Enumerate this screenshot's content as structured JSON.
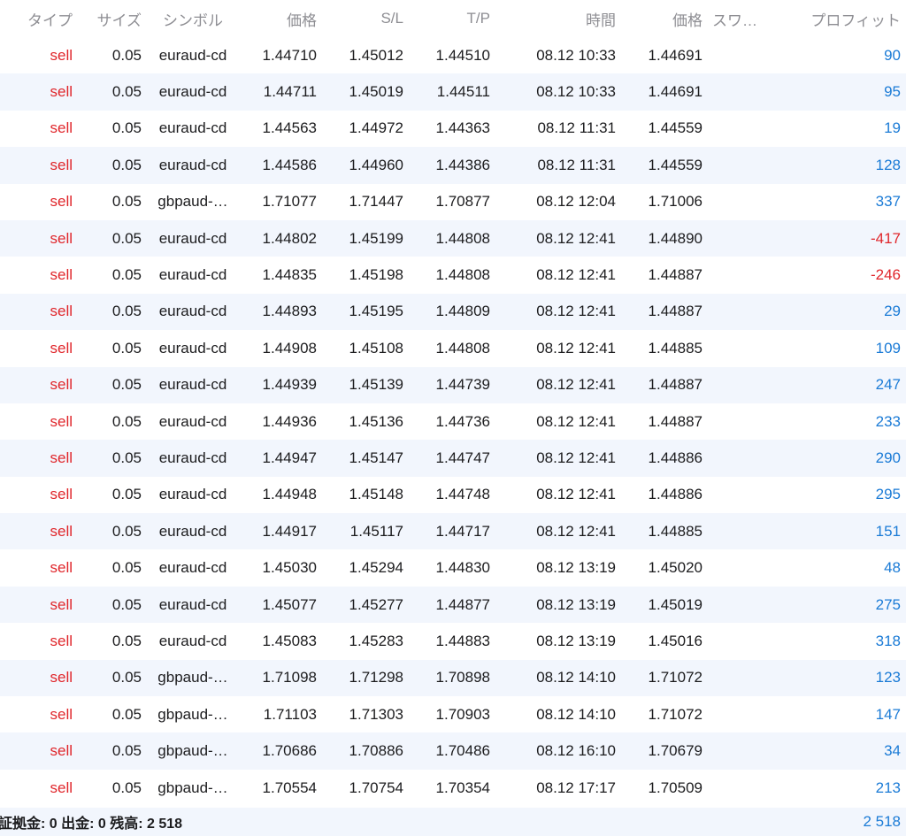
{
  "header": {
    "type": "タイプ",
    "size": "サイズ",
    "symbol": "シンボル",
    "price": "価格",
    "sl": "S/L",
    "tp": "T/P",
    "time": "時間",
    "price2": "価格",
    "swap": "スワ…",
    "profit": "プロフィット"
  },
  "colors": {
    "sell": "#e0262b",
    "positive": "#1b7bd6",
    "negative": "#e0262b",
    "row_alt_bg": "#f2f6fd",
    "header_text": "#8e8e93"
  },
  "rows": [
    {
      "type": "sell",
      "size": "0.05",
      "symbol": "euraud-cd",
      "price": "1.44710",
      "sl": "1.45012",
      "tp": "1.44510",
      "time": "08.12 10:33",
      "price2": "1.44691",
      "swap": "",
      "profit": "90"
    },
    {
      "type": "sell",
      "size": "0.05",
      "symbol": "euraud-cd",
      "price": "1.44711",
      "sl": "1.45019",
      "tp": "1.44511",
      "time": "08.12 10:33",
      "price2": "1.44691",
      "swap": "",
      "profit": "95"
    },
    {
      "type": "sell",
      "size": "0.05",
      "symbol": "euraud-cd",
      "price": "1.44563",
      "sl": "1.44972",
      "tp": "1.44363",
      "time": "08.12 11:31",
      "price2": "1.44559",
      "swap": "",
      "profit": "19"
    },
    {
      "type": "sell",
      "size": "0.05",
      "symbol": "euraud-cd",
      "price": "1.44586",
      "sl": "1.44960",
      "tp": "1.44386",
      "time": "08.12 11:31",
      "price2": "1.44559",
      "swap": "",
      "profit": "128"
    },
    {
      "type": "sell",
      "size": "0.05",
      "symbol": "gbpaud-…",
      "price": "1.71077",
      "sl": "1.71447",
      "tp": "1.70877",
      "time": "08.12 12:04",
      "price2": "1.71006",
      "swap": "",
      "profit": "337"
    },
    {
      "type": "sell",
      "size": "0.05",
      "symbol": "euraud-cd",
      "price": "1.44802",
      "sl": "1.45199",
      "tp": "1.44808",
      "time": "08.12 12:41",
      "price2": "1.44890",
      "swap": "",
      "profit": "-417"
    },
    {
      "type": "sell",
      "size": "0.05",
      "symbol": "euraud-cd",
      "price": "1.44835",
      "sl": "1.45198",
      "tp": "1.44808",
      "time": "08.12 12:41",
      "price2": "1.44887",
      "swap": "",
      "profit": "-246"
    },
    {
      "type": "sell",
      "size": "0.05",
      "symbol": "euraud-cd",
      "price": "1.44893",
      "sl": "1.45195",
      "tp": "1.44809",
      "time": "08.12 12:41",
      "price2": "1.44887",
      "swap": "",
      "profit": "29"
    },
    {
      "type": "sell",
      "size": "0.05",
      "symbol": "euraud-cd",
      "price": "1.44908",
      "sl": "1.45108",
      "tp": "1.44808",
      "time": "08.12 12:41",
      "price2": "1.44885",
      "swap": "",
      "profit": "109"
    },
    {
      "type": "sell",
      "size": "0.05",
      "symbol": "euraud-cd",
      "price": "1.44939",
      "sl": "1.45139",
      "tp": "1.44739",
      "time": "08.12 12:41",
      "price2": "1.44887",
      "swap": "",
      "profit": "247"
    },
    {
      "type": "sell",
      "size": "0.05",
      "symbol": "euraud-cd",
      "price": "1.44936",
      "sl": "1.45136",
      "tp": "1.44736",
      "time": "08.12 12:41",
      "price2": "1.44887",
      "swap": "",
      "profit": "233"
    },
    {
      "type": "sell",
      "size": "0.05",
      "symbol": "euraud-cd",
      "price": "1.44947",
      "sl": "1.45147",
      "tp": "1.44747",
      "time": "08.12 12:41",
      "price2": "1.44886",
      "swap": "",
      "profit": "290"
    },
    {
      "type": "sell",
      "size": "0.05",
      "symbol": "euraud-cd",
      "price": "1.44948",
      "sl": "1.45148",
      "tp": "1.44748",
      "time": "08.12 12:41",
      "price2": "1.44886",
      "swap": "",
      "profit": "295"
    },
    {
      "type": "sell",
      "size": "0.05",
      "symbol": "euraud-cd",
      "price": "1.44917",
      "sl": "1.45117",
      "tp": "1.44717",
      "time": "08.12 12:41",
      "price2": "1.44885",
      "swap": "",
      "profit": "151"
    },
    {
      "type": "sell",
      "size": "0.05",
      "symbol": "euraud-cd",
      "price": "1.45030",
      "sl": "1.45294",
      "tp": "1.44830",
      "time": "08.12 13:19",
      "price2": "1.45020",
      "swap": "",
      "profit": "48"
    },
    {
      "type": "sell",
      "size": "0.05",
      "symbol": "euraud-cd",
      "price": "1.45077",
      "sl": "1.45277",
      "tp": "1.44877",
      "time": "08.12 13:19",
      "price2": "1.45019",
      "swap": "",
      "profit": "275"
    },
    {
      "type": "sell",
      "size": "0.05",
      "symbol": "euraud-cd",
      "price": "1.45083",
      "sl": "1.45283",
      "tp": "1.44883",
      "time": "08.12 13:19",
      "price2": "1.45016",
      "swap": "",
      "profit": "318"
    },
    {
      "type": "sell",
      "size": "0.05",
      "symbol": "gbpaud-…",
      "price": "1.71098",
      "sl": "1.71298",
      "tp": "1.70898",
      "time": "08.12 14:10",
      "price2": "1.71072",
      "swap": "",
      "profit": "123"
    },
    {
      "type": "sell",
      "size": "0.05",
      "symbol": "gbpaud-…",
      "price": "1.71103",
      "sl": "1.71303",
      "tp": "1.70903",
      "time": "08.12 14:10",
      "price2": "1.71072",
      "swap": "",
      "profit": "147"
    },
    {
      "type": "sell",
      "size": "0.05",
      "symbol": "gbpaud-…",
      "price": "1.70686",
      "sl": "1.70886",
      "tp": "1.70486",
      "time": "08.12 16:10",
      "price2": "1.70679",
      "swap": "",
      "profit": "34"
    },
    {
      "type": "sell",
      "size": "0.05",
      "symbol": "gbpaud-…",
      "price": "1.70554",
      "sl": "1.70754",
      "tp": "1.70354",
      "time": "08.12 17:17",
      "price2": "1.70509",
      "swap": "",
      "profit": "213"
    }
  ],
  "footer": {
    "summary": "証拠金: 0 出金: 0 残高: 2 518",
    "total_profit": "2 518"
  }
}
